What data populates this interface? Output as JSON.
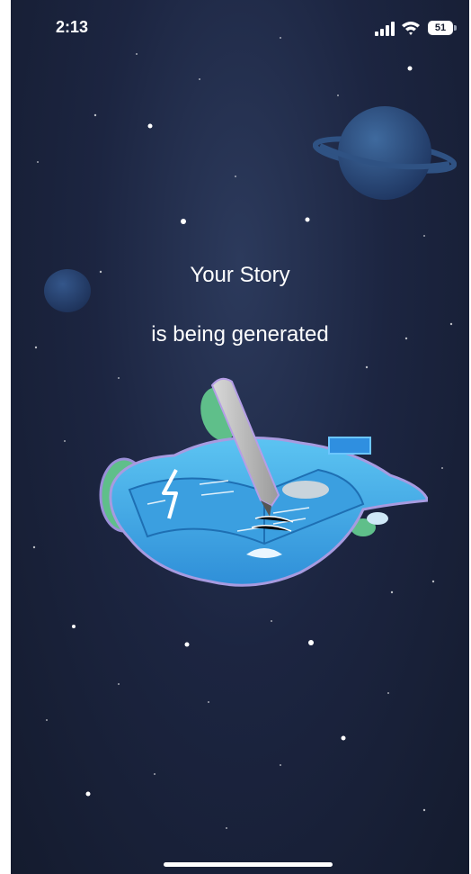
{
  "status_bar": {
    "time": "2:13",
    "battery_level": "51",
    "icons": [
      "signal-icon",
      "wifi-icon",
      "battery-icon"
    ]
  },
  "main": {
    "heading_line1": "Your Story",
    "heading_line2": "is being generated",
    "illustration": "magic-book-pen-illustration"
  },
  "colors": {
    "background": "#1c2541",
    "text": "#ffffff",
    "illustration_blue": "#3aa8e6"
  }
}
